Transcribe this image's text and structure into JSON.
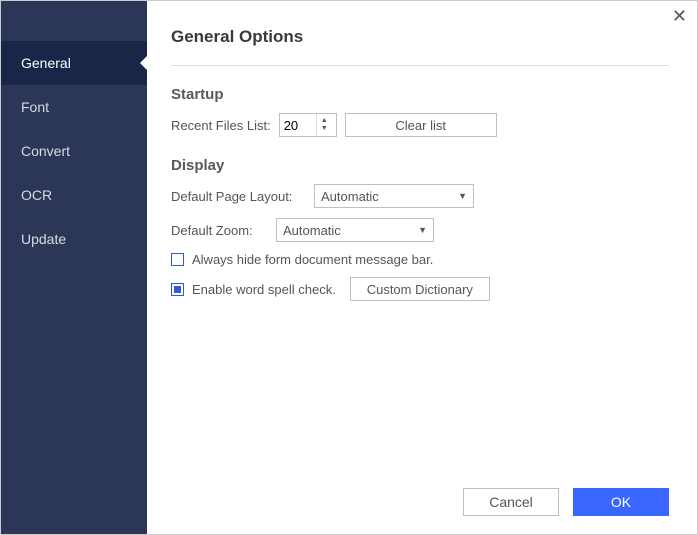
{
  "sidebar": {
    "items": [
      {
        "label": "General"
      },
      {
        "label": "Font"
      },
      {
        "label": "Convert"
      },
      {
        "label": "OCR"
      },
      {
        "label": "Update"
      }
    ]
  },
  "main": {
    "title": "General Options",
    "startup": {
      "heading": "Startup",
      "recentLabel": "Recent Files List:",
      "recentValue": "20",
      "clearButton": "Clear list"
    },
    "display": {
      "heading": "Display",
      "layoutLabel": "Default Page Layout:",
      "layoutValue": "Automatic",
      "zoomLabel": "Default Zoom:",
      "zoomValue": "Automatic",
      "hideFormLabel": "Always hide form document message bar.",
      "spellLabel": "Enable word spell check.",
      "dictionaryButton": "Custom Dictionary"
    }
  },
  "footer": {
    "cancel": "Cancel",
    "ok": "OK"
  }
}
